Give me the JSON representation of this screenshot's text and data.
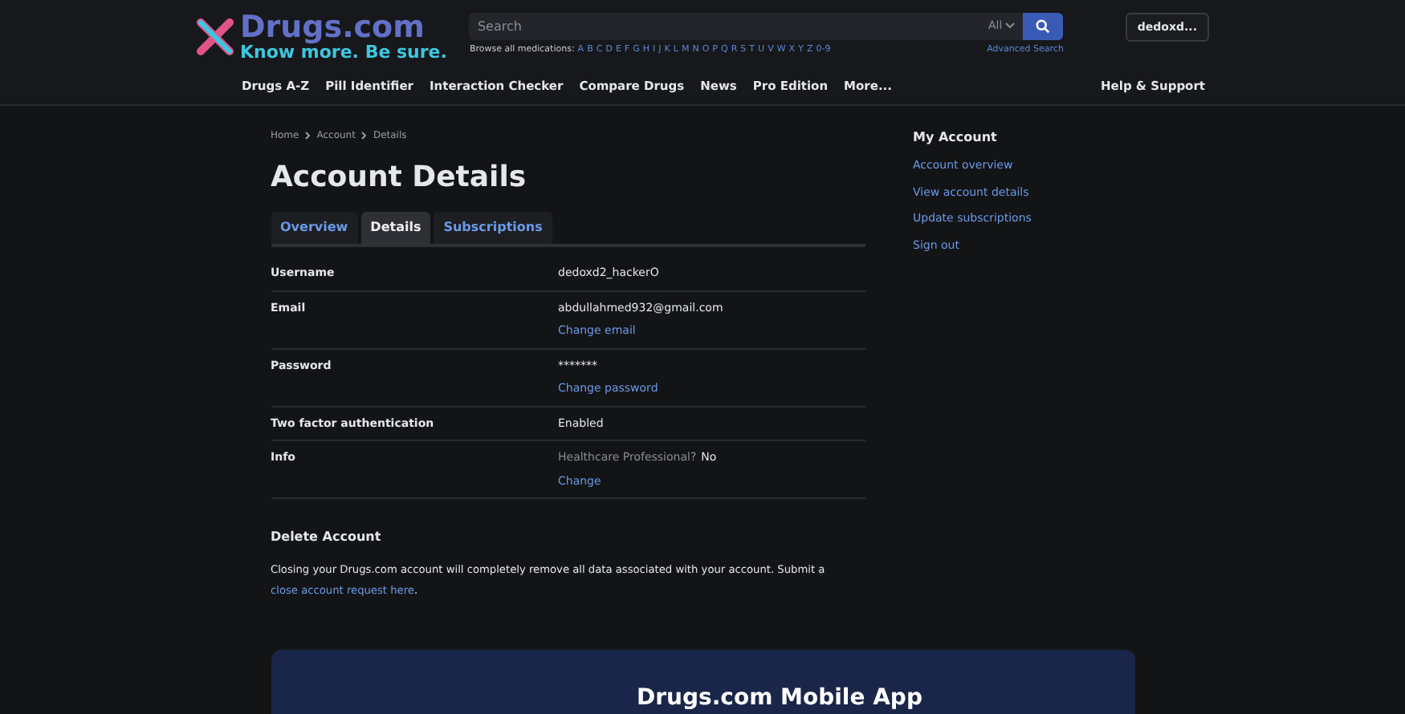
{
  "header": {
    "logo": {
      "name": "Drugs.com",
      "tagline": "Know more. Be sure."
    },
    "search": {
      "placeholder": "Search",
      "scope": "All"
    },
    "browse": {
      "label": "Browse all medications:",
      "letters": [
        "A",
        "B",
        "C",
        "D",
        "E",
        "F",
        "G",
        "H",
        "I",
        "J",
        "K",
        "L",
        "M",
        "N",
        "O",
        "P",
        "Q",
        "R",
        "S",
        "T",
        "U",
        "V",
        "W",
        "X",
        "Y",
        "Z",
        "0-9"
      ]
    },
    "advanced_search": "Advanced Search",
    "user": "dedoxd..."
  },
  "nav": {
    "items": [
      "Drugs A-Z",
      "Pill Identifier",
      "Interaction Checker",
      "Compare Drugs",
      "News",
      "Pro Edition",
      "More..."
    ],
    "help": "Help & Support"
  },
  "breadcrumb": [
    "Home",
    "Account",
    "Details"
  ],
  "title": "Account Details",
  "tabs": [
    {
      "label": "Overview",
      "selected": false
    },
    {
      "label": "Details",
      "selected": true
    },
    {
      "label": "Subscriptions",
      "selected": false
    }
  ],
  "rows": [
    {
      "label": "Username",
      "value": "dedoxd2_hackerO"
    },
    {
      "label": "Email",
      "value": "abdullahmed932@gmail.com",
      "link": "Change email"
    },
    {
      "label": "Password",
      "value": "*******",
      "link": "Change password"
    },
    {
      "label": "Two factor authentication",
      "value": "Enabled"
    },
    {
      "label": "Info",
      "prefix": "Healthcare Professional?",
      "value": "No",
      "link": "Change"
    }
  ],
  "delete": {
    "heading": "Delete Account",
    "text": "Closing your Drugs.com account will completely remove all data associated with your account. Submit a",
    "link": "close account request here",
    "end": "."
  },
  "sidebar": {
    "heading": "My Account",
    "links": [
      "Account overview",
      "View account details",
      "Update subscriptions",
      "Sign out"
    ]
  },
  "banner": {
    "title": "Drugs.com Mobile App"
  }
}
